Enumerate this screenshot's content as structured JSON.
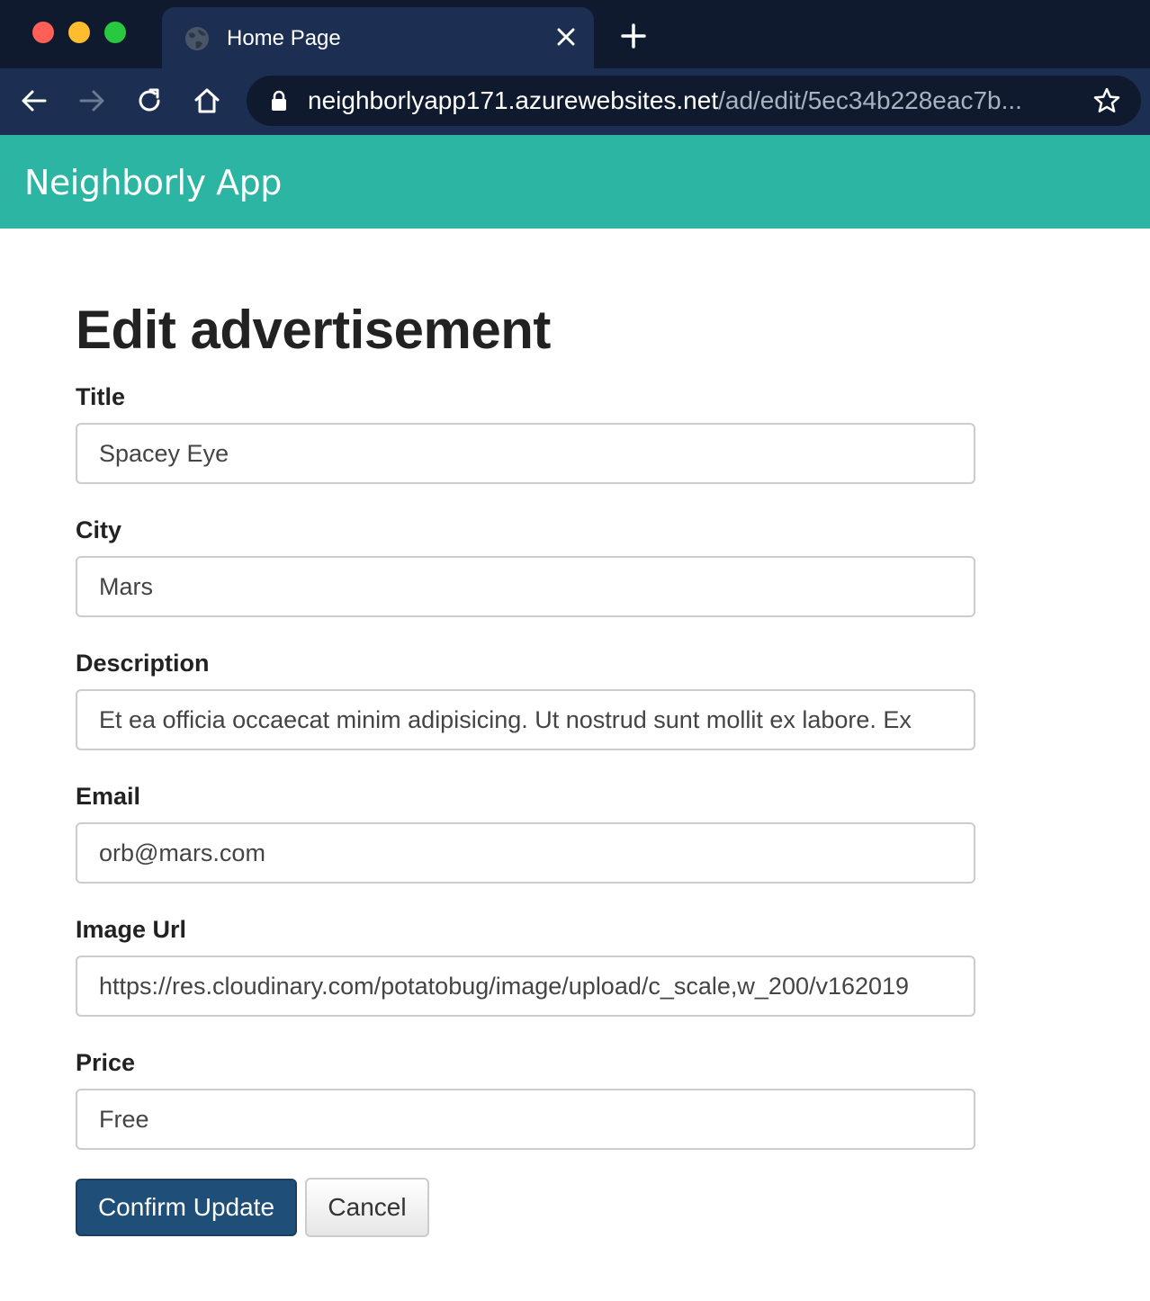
{
  "browser": {
    "tab_title": "Home Page",
    "url_host": "neighborlyapp171.azurewebsites.net",
    "url_path": "/ad/edit/5ec34b228eac7b..."
  },
  "app": {
    "brand": "Neighborly App"
  },
  "form": {
    "heading": "Edit advertisement",
    "fields": [
      {
        "label": "Title",
        "value": "Spacey Eye"
      },
      {
        "label": "City",
        "value": "Mars"
      },
      {
        "label": "Description",
        "value": "Et ea officia occaecat minim adipisicing. Ut nostrud sunt mollit ex labore. Ex"
      },
      {
        "label": "Email",
        "value": "orb@mars.com"
      },
      {
        "label": "Image Url",
        "value": "https://res.cloudinary.com/potatobug/image/upload/c_scale,w_200/v162019"
      },
      {
        "label": "Price",
        "value": "Free"
      }
    ],
    "confirm_label": "Confirm Update",
    "cancel_label": "Cancel"
  },
  "colors": {
    "navbar": "#2bb5a2",
    "primary_button": "#1f4e79",
    "browser_frame": "#0f1a2e",
    "browser_toolbar": "#1c2f52"
  },
  "icons": [
    "globe-icon",
    "close-icon",
    "plus-icon",
    "back-arrow-icon",
    "forward-arrow-icon",
    "reload-icon",
    "home-icon",
    "lock-icon",
    "star-icon"
  ]
}
